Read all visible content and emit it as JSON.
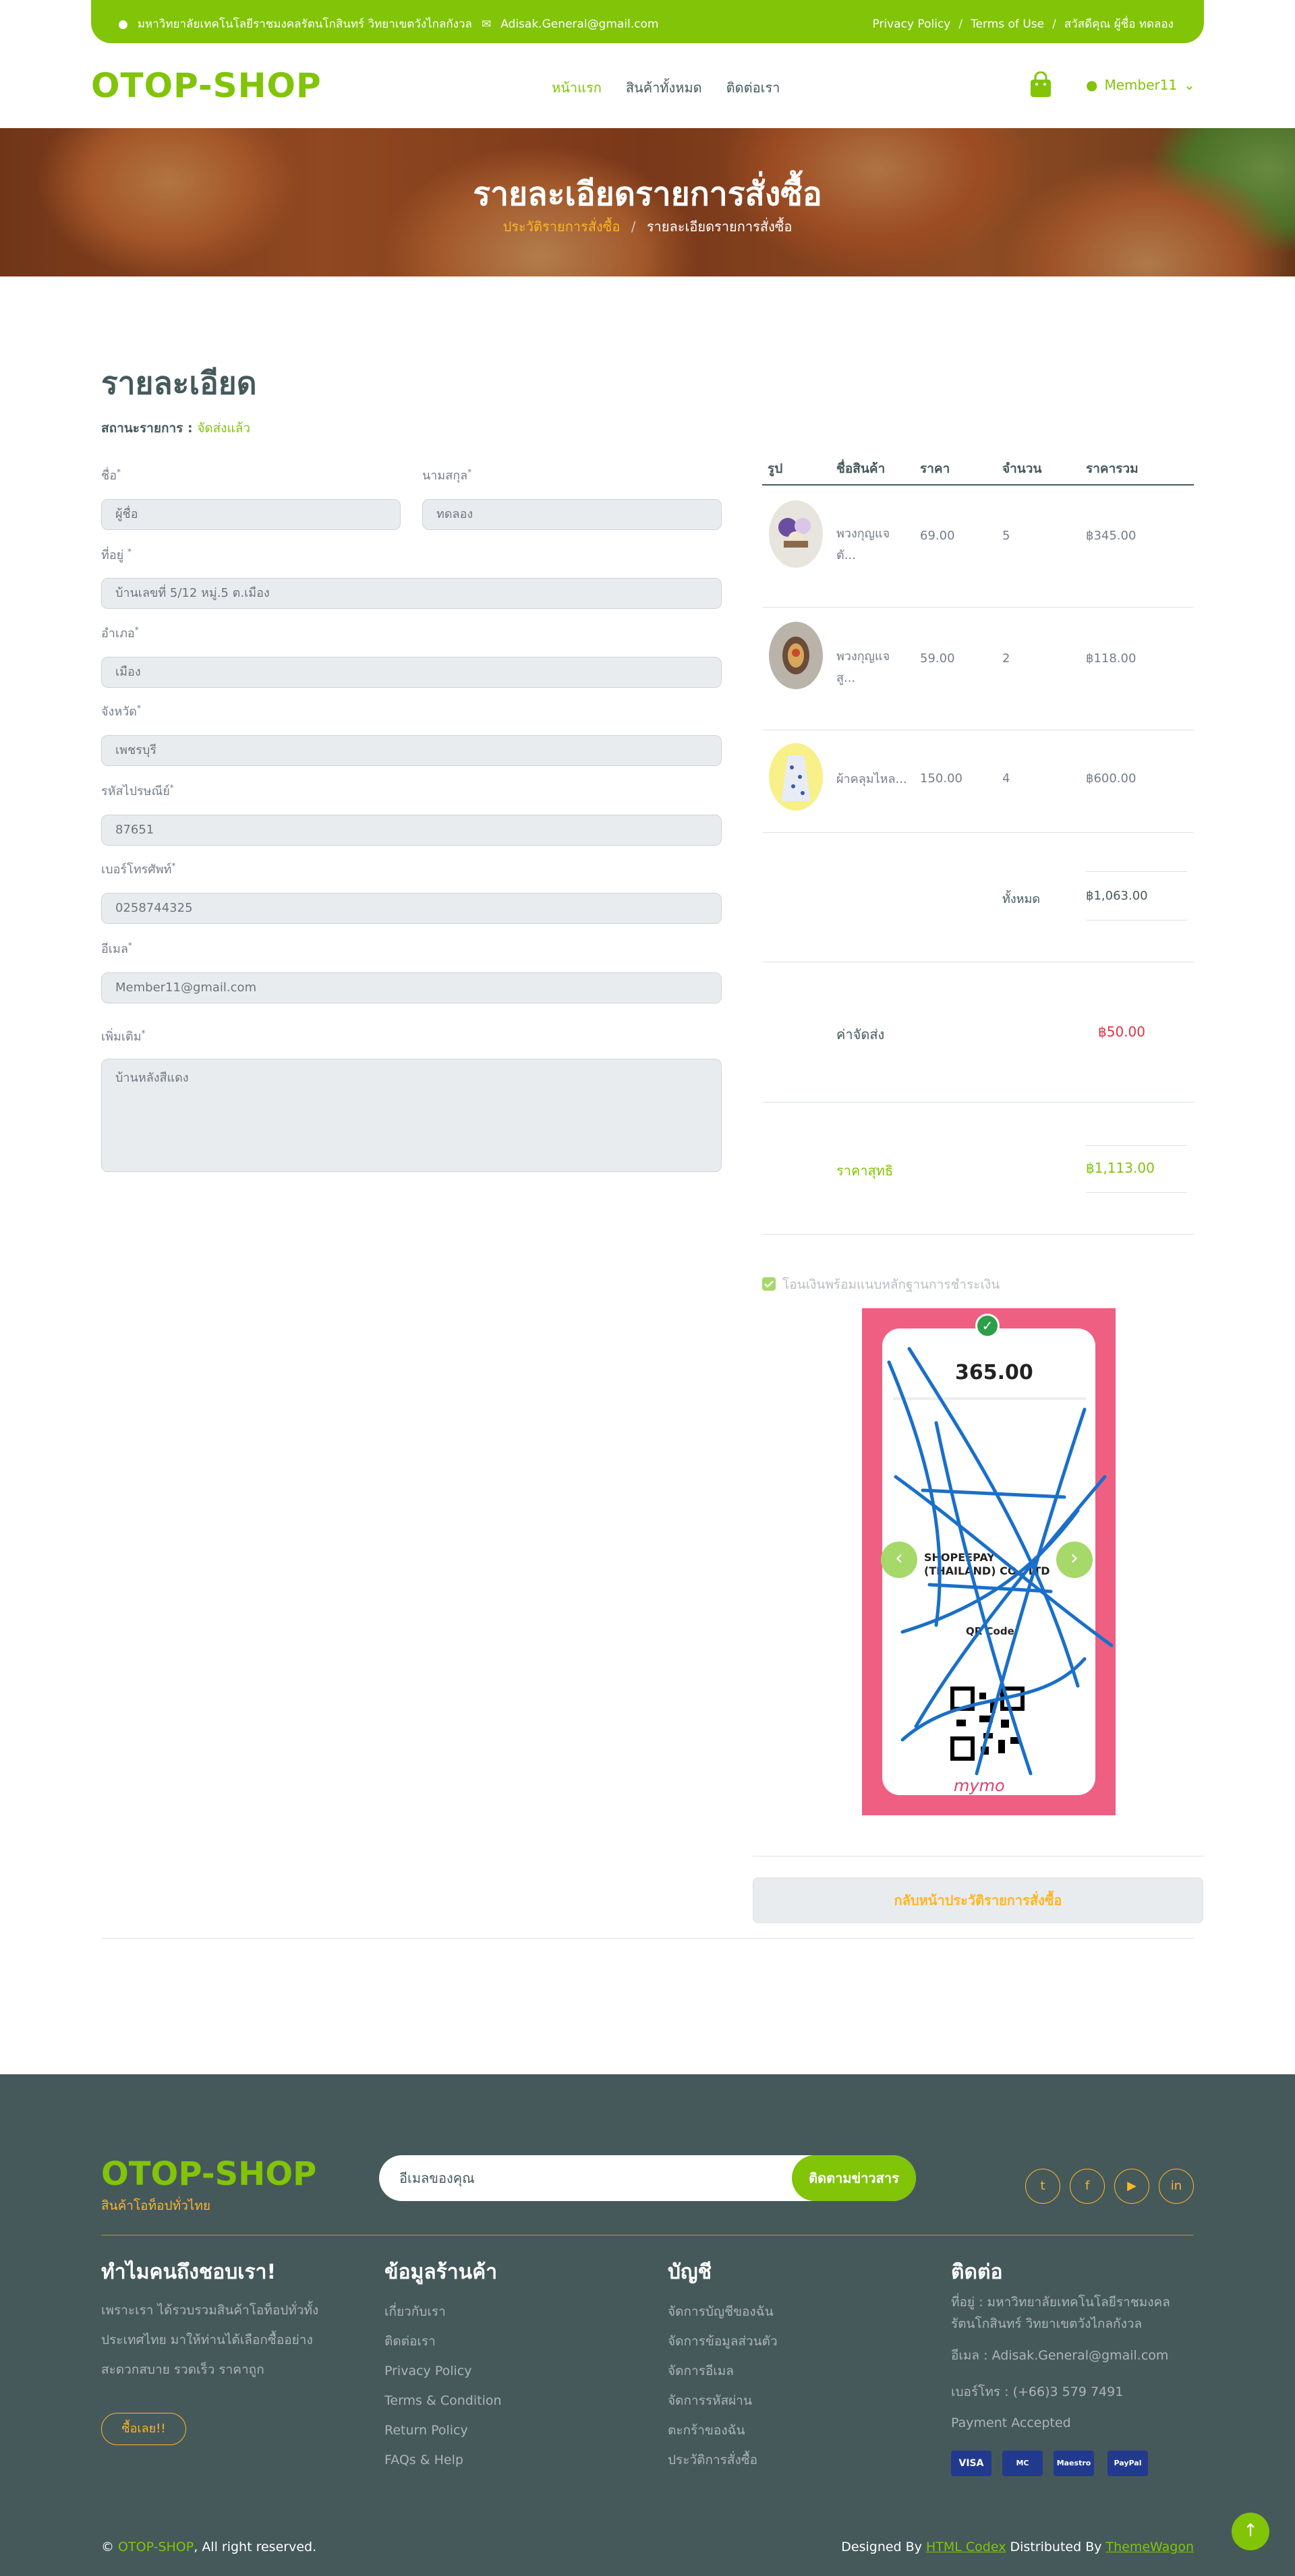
{
  "topbar": {
    "address": "มหาวิทยาลัยเทคโนโลยีราชมงคลรัตนโกสินทร์ วิทยาเขตวังไกลกังวล",
    "email": "Adisak.General@gmail.com",
    "privacy": "Privacy Policy",
    "terms": "Terms of Use",
    "greeting": "สวัสดีคุณ ผู้ชื่อ ทดลอง",
    "sep": "/"
  },
  "navbar": {
    "logo": "OTOP-SHOP",
    "links": [
      "หน้าแรก",
      "สินค้าทั้งหมด",
      "ติดต่อเรา"
    ],
    "member": "Member11"
  },
  "hero": {
    "title": "รายละเอียดรายการสั่งซื้อ",
    "crumb1": "ประวัติรายการสั่งซื้อ",
    "crumb_sep": "/",
    "crumb2": "รายละเอียดรายการสั่งซื้อ"
  },
  "detail": {
    "heading": "รายละเอียด",
    "status_label": "สถานะรายการ :",
    "status_value": "จัดส่งแล้ว"
  },
  "form": {
    "first_name_label": "ชื่อ",
    "first_name": "ผู้ชื่อ",
    "last_name_label": "นามสกุล",
    "last_name": "ทดลอง",
    "address_label": "ที่อยู่",
    "address": "บ้านเลขที่ 5/12 หมู่.5 ต.เมือง",
    "district_label": "อำเภอ",
    "district": "เมือง",
    "province_label": "จังหวัด",
    "province": "เพชรบุรี",
    "zip_label": "รหัสไปรษณีย์",
    "zip": "87651",
    "phone_label": "เบอร์โทรศัพท์",
    "phone": "0258744325",
    "email_label": "อีเมล",
    "email": "Member11@gmail.com",
    "note_label": "เพิ่มเติม",
    "note": "บ้านหลังสีแดง",
    "required": "*"
  },
  "table": {
    "headers": [
      "รูป",
      "ชื่อสินค้า",
      "ราคา",
      "จำนวน",
      "ราคารวม"
    ],
    "rows": [
      {
        "name": "พวงกุญแจ ตั...",
        "price": "69.00",
        "qty": "5",
        "total": "฿345.00"
      },
      {
        "name": "พวงกุญแจ สู...",
        "price": "59.00",
        "qty": "2",
        "total": "฿118.00"
      },
      {
        "name": "ผ้าคลุมไหล...",
        "price": "150.00",
        "qty": "4",
        "total": "฿600.00"
      }
    ],
    "sum_label": "ทั้งหมด",
    "sum_value": "฿1,063.00",
    "shipping_label": "ค่าจัดส่ง",
    "shipping_value": "฿50.00",
    "net_label": "ราคาสุทธิ",
    "net_value": "฿1,113.00"
  },
  "payment": {
    "check_label": "โอนเงินพร้อมแนบหลักฐานการชำระเงิน",
    "slip_amount": "365.00",
    "slip_bank": "SHOPEEPAY (THAILAND) CO., LTD",
    "slip_qr": "QR Code",
    "slip_brand": "mymo"
  },
  "back_button": "กลับหน้าประวัติรายการสั่งซื้อ",
  "footer": {
    "logo": "OTOP-SHOP",
    "tagline": "สินค้าโอท็อปทั่วไทย",
    "email_placeholder": "อีเมลของคุณ",
    "subscribe": "ติดตามข่าวสาร",
    "col1_title": "ทำไมคนถึงชอบเรา!",
    "col1_text": [
      "เพราะเรา ได้รวบรวมสินค้าโอท็อปทั่วทั้ง",
      "ประเทศไทย มาให้ท่านได้เลือกซื้ออย่าง",
      "สะดวกสบาย รวดเร็ว ราคาถูก"
    ],
    "col1_button": "ซื้อเลย!!",
    "col2_title": "ข้อมูลร้านค้า",
    "col2_items": [
      "เกี่ยวกับเรา",
      "ติดต่อเรา",
      "Privacy Policy",
      "Terms & Condition",
      "Return Policy",
      "FAQs & Help"
    ],
    "col3_title": "บัญชี",
    "col3_items": [
      "จัดการบัญชีของฉัน",
      "จัดการข้อมูลส่วนตัว",
      "จัดการอีเมล",
      "จัดการรหัสผ่าน",
      "ตะกร้าของฉัน",
      "ประวัติการสั่งซื้อ"
    ],
    "col4_title": "ติดต่อ",
    "col4_address": [
      "ที่อยู่ : มหาวิทยาลัยเทคโนโลยีราชมงคล",
      "รัตนโกสินทร์ วิทยาเขตวังไกลกังวล"
    ],
    "col4_email": "อีเมล : Adisak.General@gmail.com",
    "col4_phone": "เบอร์โทร : (+66)3 579 7491",
    "col4_payment": "Payment Accepted",
    "pay_cards": [
      "VISA",
      "MC",
      "Maestro",
      "PayPal"
    ],
    "copyright_brand": "OTOP-SHOP",
    "copyright_rest": ", All right reserved.",
    "designed_by": "Designed By",
    "designer": "HTML Codex",
    "distributed_by": "Distributed By",
    "distributor": "ThemeWagon"
  },
  "colors": {
    "primary": "#81c408",
    "secondary": "#ffb524",
    "dark": "#45595b",
    "danger": "#dc3545"
  },
  "icons": [
    "map-marker-icon",
    "envelope-icon",
    "shopping-bag-icon",
    "user-icon",
    "chevron-down-icon",
    "check-icon",
    "chevron-left-icon",
    "chevron-right-icon",
    "twitter-icon",
    "facebook-icon",
    "youtube-icon",
    "linkedin-icon",
    "copyright-icon",
    "arrow-up-icon"
  ]
}
